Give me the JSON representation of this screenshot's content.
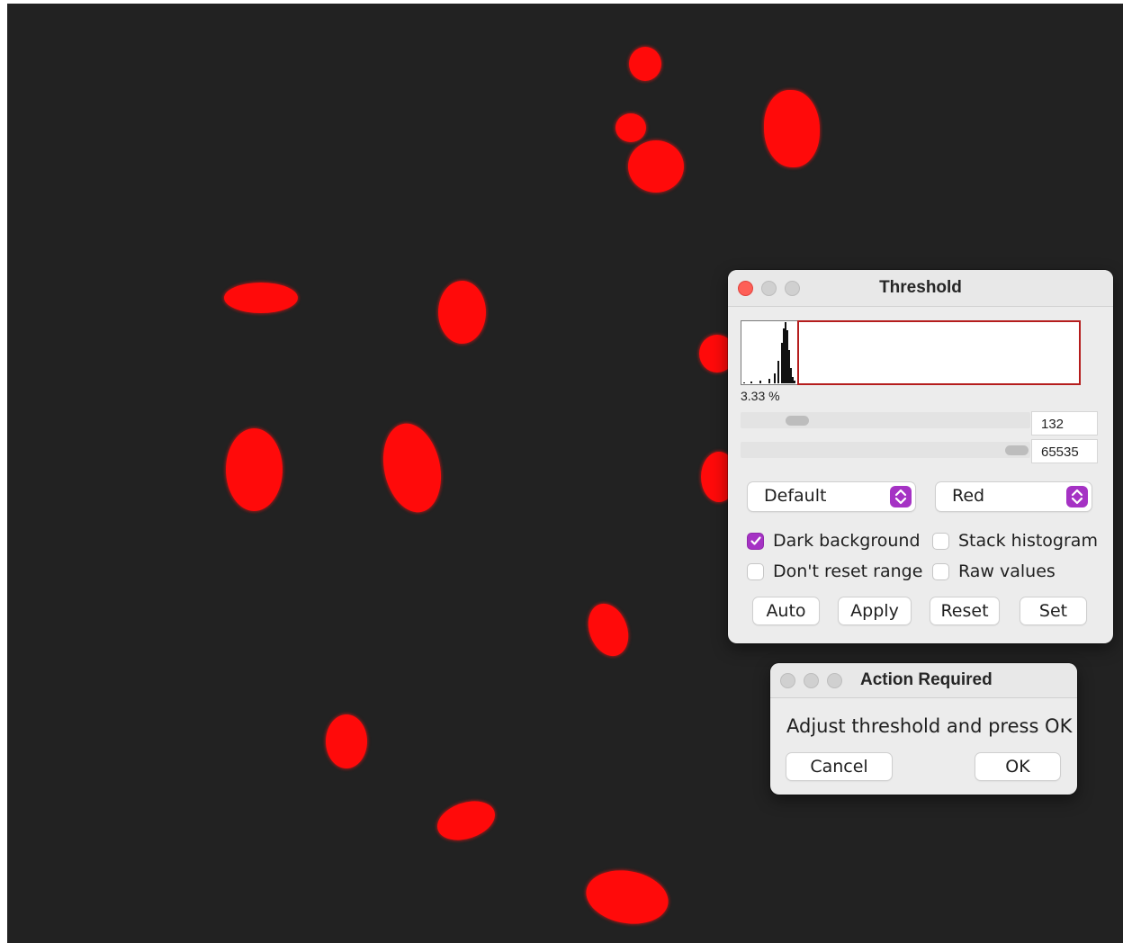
{
  "image": {
    "description_icon": "microscopy-image",
    "background_color": "#222222",
    "cell_color": "#ff0a0a"
  },
  "threshold_window": {
    "title": "Threshold",
    "histogram": {
      "percent_label": "3.33 %",
      "range_color": "#b51d1d"
    },
    "lower_slider": {
      "value": "132",
      "fraction": 0.12
    },
    "upper_slider": {
      "value": "65535",
      "fraction": 0.96
    },
    "method_select": {
      "selected": "Default"
    },
    "display_select": {
      "selected": "Red"
    },
    "checkboxes": {
      "dark_background": {
        "label": "Dark background",
        "checked": true
      },
      "stack_histogram": {
        "label": "Stack histogram",
        "checked": false
      },
      "dont_reset_range": {
        "label": "Don't reset range",
        "checked": false
      },
      "raw_values": {
        "label": "Raw values",
        "checked": false
      }
    },
    "buttons": {
      "auto": "Auto",
      "apply": "Apply",
      "reset": "Reset",
      "set": "Set"
    },
    "accent_color": "#a532c4"
  },
  "action_window": {
    "title": "Action Required",
    "message": "Adjust threshold and press OK",
    "buttons": {
      "cancel": "Cancel",
      "ok": "OK"
    }
  }
}
